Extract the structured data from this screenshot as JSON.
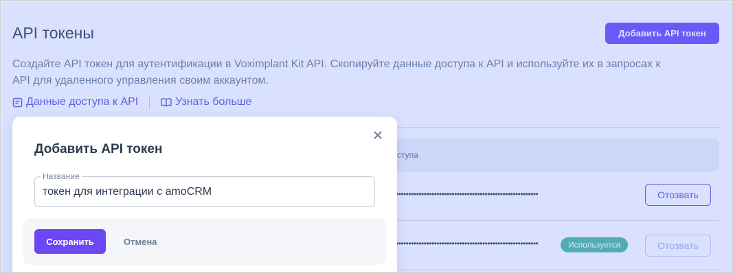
{
  "page": {
    "title": "API токены",
    "add_button": "Добавить API токен",
    "description": "Создайте API токен для аутентификации в Voximplant Kit API. Скопируйте данные доступа к API и используйте их в запросах к API для удаленного управления своим аккаунтом.",
    "links": {
      "api_access": "Данные доступа к API",
      "learn_more": "Узнать больше"
    }
  },
  "table": {
    "header_fragment": "ступа",
    "rows": [
      {
        "token_mask": "••••••••••••••••••••••••••••••••••••••••••••••••••••••••",
        "revoke_label": "Отозвать"
      },
      {
        "token_mask": "••••••••••••••••••••••••••••••••••••••••••••••••••••••••",
        "status": "Используется",
        "revoke_label": "Отозвать"
      }
    ]
  },
  "modal": {
    "title": "Добавить API токен",
    "field": {
      "label": "Название",
      "value": "токен для интеграции с amoCRM"
    },
    "save_label": "Сохранить",
    "cancel_label": "Отмена"
  },
  "colors": {
    "accent": "#6b47f5",
    "link": "#5a4fd8",
    "status_green": "#4bb79a",
    "overlay": "#6c8cff"
  }
}
